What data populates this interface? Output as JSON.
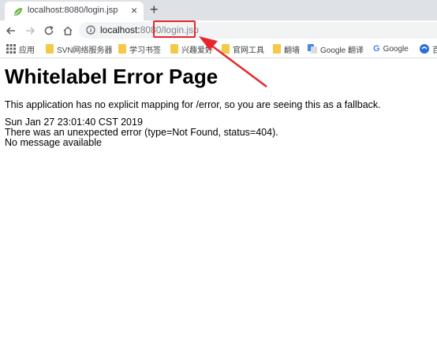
{
  "tab": {
    "title": "localhost:8080/login.jsp",
    "close": "×",
    "new_tab": "+"
  },
  "address": {
    "host": "localhost:",
    "port": "8080",
    "path": "/login.jsp"
  },
  "bookmarks": [
    {
      "label": "应用",
      "icon": "apps-icon"
    },
    {
      "label": "SVN网络服务器",
      "icon": "folder-icon"
    },
    {
      "label": "学习书签",
      "icon": "folder-icon"
    },
    {
      "label": "兴趣爱好",
      "icon": "folder-icon"
    },
    {
      "label": "官网工具",
      "icon": "folder-icon"
    },
    {
      "label": "翻墙",
      "icon": "folder-icon"
    },
    {
      "label": "Google 翻译",
      "icon": "google-translate-icon"
    },
    {
      "label": "Google",
      "icon": "google-icon"
    },
    {
      "label": "百",
      "icon": "baidu-icon"
    }
  ],
  "page": {
    "heading": "Whitelabel Error Page",
    "explanation": "This application has no explicit mapping for /error, so you are seeing this as a fallback.",
    "timestamp": "Sun Jan 27 23:01:40 CST 2019",
    "error_line": "There was an unexpected error (type=Not Found, status=404).",
    "message": "No message available"
  },
  "colors": {
    "annotation_red": "#e8272d",
    "tabstrip": "#dee1e6",
    "omnibox": "#f1f3f4"
  }
}
